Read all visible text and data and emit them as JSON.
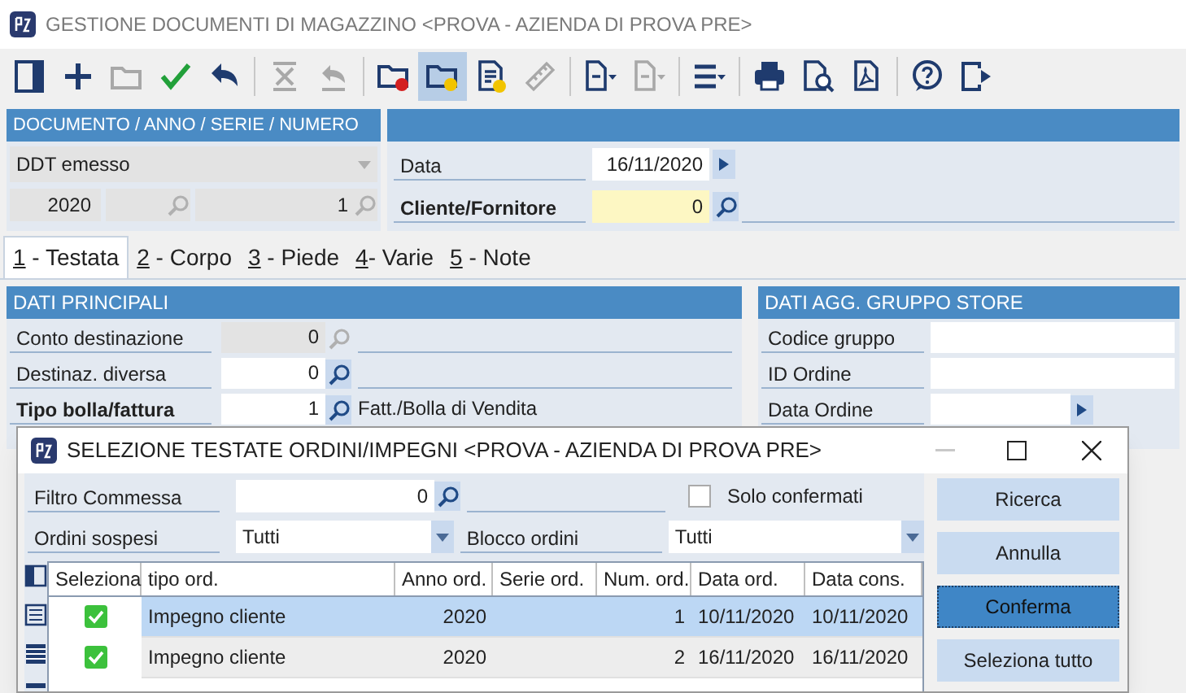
{
  "window": {
    "title": "GESTIONE DOCUMENTI DI MAGAZZINO <PROVA - AZIENDA DI PROVA PRE>"
  },
  "toolbar": [
    {
      "kind": "page",
      "disabled": false,
      "active": false
    },
    {
      "kind": "plus",
      "disabled": false,
      "active": false
    },
    {
      "kind": "folder",
      "disabled": true,
      "active": false
    },
    {
      "kind": "check",
      "disabled": false,
      "active": false
    },
    {
      "kind": "undo",
      "disabled": false,
      "active": false
    },
    {
      "kind": "separator"
    },
    {
      "kind": "cross",
      "disabled": true,
      "active": false
    },
    {
      "kind": "undo-bar",
      "disabled": true,
      "active": false
    },
    {
      "kind": "separator"
    },
    {
      "kind": "folder-red",
      "disabled": false,
      "active": false
    },
    {
      "kind": "folder-yellow",
      "disabled": false,
      "active": true
    },
    {
      "kind": "doc-yellow",
      "disabled": false,
      "active": false
    },
    {
      "kind": "ruler",
      "disabled": true,
      "active": false
    },
    {
      "kind": "separator"
    },
    {
      "kind": "doc-menu",
      "disabled": false,
      "active": false
    },
    {
      "kind": "doc-menu",
      "disabled": true,
      "active": false
    },
    {
      "kind": "separator"
    },
    {
      "kind": "list-menu",
      "disabled": false,
      "active": false
    },
    {
      "kind": "separator"
    },
    {
      "kind": "printer",
      "disabled": false,
      "active": false
    },
    {
      "kind": "preview",
      "disabled": false,
      "active": false
    },
    {
      "kind": "pdf",
      "disabled": false,
      "active": false
    },
    {
      "kind": "separator"
    },
    {
      "kind": "help",
      "disabled": false,
      "active": false
    },
    {
      "kind": "exit",
      "disabled": false,
      "active": false
    }
  ],
  "document_panel": {
    "header": "DOCUMENTO / ANNO / SERIE / NUMERO",
    "doc_type": "DDT emesso",
    "anno": "2020",
    "numero": "1"
  },
  "head_fields": [
    {
      "label": "Data",
      "value": "16/11/2020",
      "emphasized": false,
      "required": false,
      "kind": "date"
    },
    {
      "label": "Cliente/Fornitore",
      "value": "0",
      "emphasized": true,
      "required": true,
      "kind": "lookup"
    }
  ],
  "tabs": [
    {
      "key": "1",
      "label": " - Testata",
      "selected": true
    },
    {
      "key": "2",
      "label": " - Corpo",
      "selected": false
    },
    {
      "key": "3",
      "label": " - Piede",
      "selected": false
    },
    {
      "key": "4",
      "label": "- Varie",
      "selected": false
    },
    {
      "key": "5",
      "label": " - Note",
      "selected": false
    }
  ],
  "dati_principali": {
    "header": "DATI PRINCIPALI",
    "rows": [
      {
        "label": "Conto destinazione",
        "value": "0",
        "disabled": true,
        "emphasized": false
      },
      {
        "label": "Destinaz. diversa",
        "value": "0",
        "disabled": false,
        "emphasized": false
      },
      {
        "label": "Tipo bolla/fattura",
        "value": "1",
        "disabled": false,
        "emphasized": true,
        "description": "Fatt./Bolla di Vendita"
      }
    ]
  },
  "dati_agg": {
    "header": "DATI AGG. GRUPPO STORE",
    "rows": [
      {
        "label": "Codice gruppo",
        "kind": "text"
      },
      {
        "label": "ID Ordine",
        "kind": "text"
      },
      {
        "label": "Data Ordine",
        "kind": "date"
      }
    ]
  },
  "dialog": {
    "title": "SELEZIONE TESTATE ORDINI/IMPEGNI <PROVA - AZIENDA DI PROVA PRE>",
    "filtro_commessa": {
      "label": "Filtro Commessa",
      "value": "0"
    },
    "solo_confermati": {
      "label": "Solo confermati",
      "checked": false
    },
    "ordini_sospesi": {
      "label": "Ordini sospesi",
      "value": "Tutti"
    },
    "blocco_ordini": {
      "label": "Blocco ordini",
      "value": "Tutti"
    },
    "columns": [
      "Seleziona",
      "tipo ord.",
      "Anno ord.",
      "Serie ord.",
      "Num. ord.",
      "Data ord.",
      "Data cons."
    ],
    "rows": [
      {
        "checked": true,
        "selected": true,
        "tipo": "Impegno cliente",
        "anno": "2020",
        "num": "1",
        "data_ord": "10/11/2020",
        "data_cons": "10/11/2020"
      },
      {
        "checked": true,
        "selected": false,
        "tipo": "Impegno cliente",
        "anno": "2020",
        "num": "2",
        "data_ord": "16/11/2020",
        "data_cons": "16/11/2020"
      }
    ],
    "buttons": [
      {
        "label": "Ricerca",
        "selected": false
      },
      {
        "label": "Annulla",
        "selected": false
      },
      {
        "label": "Conferma",
        "selected": true
      },
      {
        "label": "Seleziona tutto",
        "selected": false
      }
    ]
  }
}
